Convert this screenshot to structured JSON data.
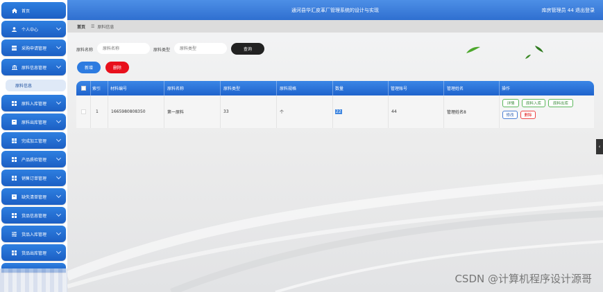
{
  "header": {
    "title": "通河县华汇皮革厂管理系统的设计与实现",
    "user_info": "库房管理员 44  退出登录"
  },
  "sidebar": {
    "items": [
      {
        "label": "首页",
        "icon": "home-icon"
      },
      {
        "label": "个人中心",
        "icon": "user-icon"
      },
      {
        "label": "采购申请管理",
        "icon": "list-icon"
      },
      {
        "label": "原料信息管理",
        "icon": "bank-icon"
      },
      {
        "label": "原料入库管理",
        "icon": "grid-icon"
      },
      {
        "label": "原料出库管理",
        "icon": "box-icon"
      },
      {
        "label": "完成加工管理",
        "icon": "table-icon"
      },
      {
        "label": "产品质检管理",
        "icon": "grid-icon"
      },
      {
        "label": "销售订单管理",
        "icon": "grid-icon"
      },
      {
        "label": "缺失清单管理",
        "icon": "box-icon"
      },
      {
        "label": "货品信息管理",
        "icon": "grid-icon"
      },
      {
        "label": "货品入库管理",
        "icon": "sliders-icon"
      },
      {
        "label": "货品出库管理",
        "icon": "grid-icon"
      }
    ],
    "active_sub": "原料信息"
  },
  "breadcrumb": {
    "home": "首页",
    "current": "原料信息"
  },
  "search": {
    "name_label": "原料名称",
    "name_placeholder": "原料名称",
    "type_label": "原料类型",
    "type_placeholder": "原料类型",
    "query_button": "查询"
  },
  "actions": {
    "add": "新增",
    "delete": "删除"
  },
  "table": {
    "columns": [
      "索引",
      "材料编号",
      "原料名称",
      "原料类型",
      "原料规格",
      "数量",
      "管理账号",
      "管理姓名",
      "操作"
    ],
    "rows": [
      {
        "index": "1",
        "code": "1665980808350",
        "name": "第一原料",
        "type": "33",
        "spec": "个",
        "qty": "22",
        "account": "44",
        "manager": "管理姓名8",
        "ops": [
          "详情",
          "原料入库",
          "原料出库",
          "修改",
          "删除"
        ]
      }
    ]
  },
  "watermark": "CSDN @计算机程序设计源哥",
  "colors": {
    "primary": "#2d7be0",
    "danger": "#e8101c",
    "dark": "#222222"
  }
}
